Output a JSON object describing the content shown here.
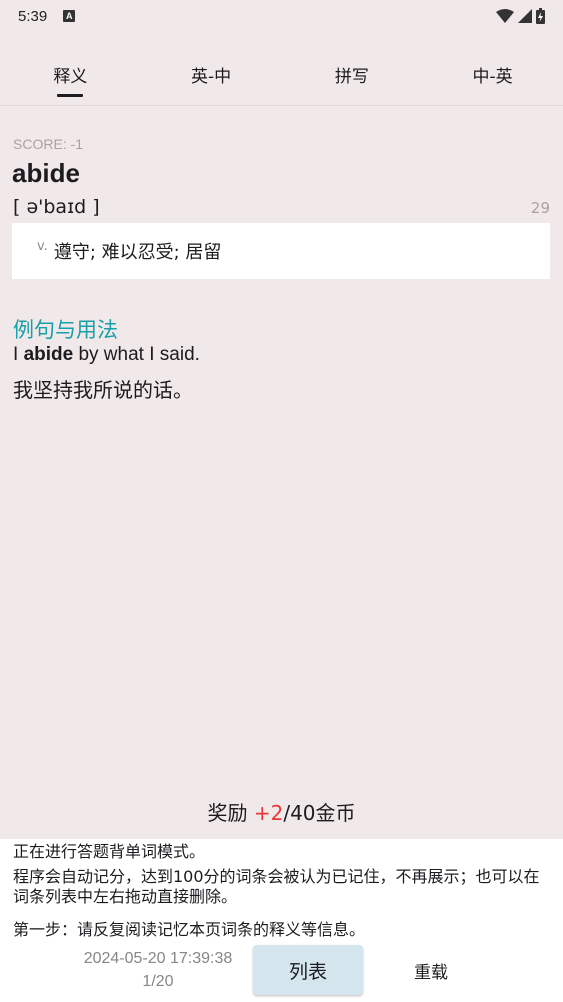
{
  "status_bar": {
    "time": "5:39",
    "notification_icon": "A",
    "icons": [
      "wifi-icon",
      "signal-icon",
      "battery-charging-icon"
    ]
  },
  "tabs": [
    {
      "label": "释义",
      "active": true
    },
    {
      "label": "英-中",
      "active": false
    },
    {
      "label": "拼写",
      "active": false
    },
    {
      "label": "中-英",
      "active": false
    }
  ],
  "word_card": {
    "score": "SCORE: -1",
    "word": "abide",
    "phonetic": "[ ə'baɪd ]",
    "count": "29",
    "pos": "v.",
    "meaning": "遵守; 难以忍受; 居留"
  },
  "examples": {
    "title": "例句与用法",
    "en_prefix": "I ",
    "en_word": "abide",
    "en_suffix": " by what I said.",
    "zh": "我坚持我所说的话。"
  },
  "reward": {
    "prefix": "奖励 ",
    "plus": "+2",
    "suffix": "/40金币"
  },
  "info": {
    "line1": "正在进行答题背单词模式。",
    "line2": "程序会自动记分，达到100分的词条会被认为已记住，不再展示；也可以在词条列表中左右拖动直接删除。",
    "line3": "第一步：请反复阅读记忆本页词条的释义等信息。"
  },
  "footer": {
    "datetime": "2024-05-20 17:39:38",
    "page": "1/20",
    "list_label": "列表",
    "reload_label": "重载"
  },
  "colors": {
    "background": "#f1e8e9",
    "accent_teal": "#16a0a8",
    "reward_red": "#e53935",
    "list_button": "#d4e5ee"
  }
}
